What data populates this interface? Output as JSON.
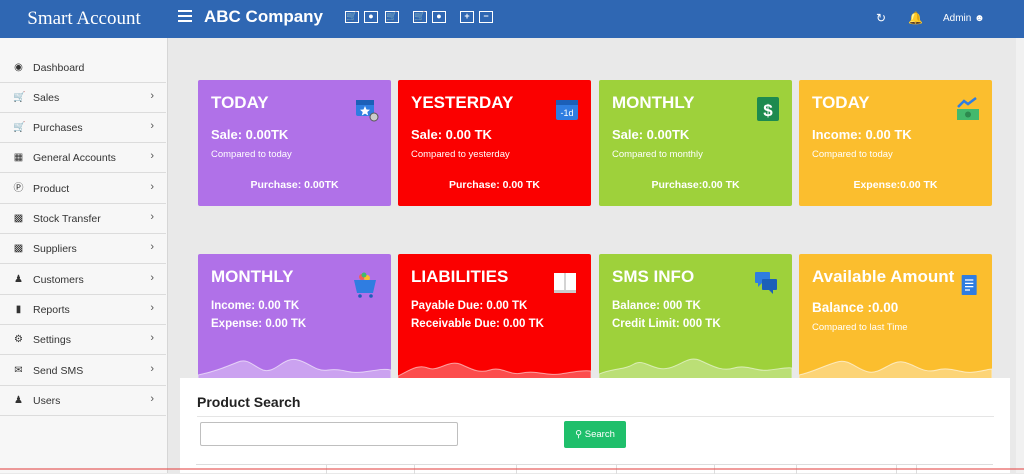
{
  "header": {
    "brand": "Smart Account",
    "company": "ABC Company",
    "admin": "Admin",
    "toolbar_icons": [
      "cart-icon",
      "cash-icon",
      "cart-icon",
      "cart-icon",
      "cash-icon",
      "plus-icon",
      "minus-icon"
    ]
  },
  "sidebar": {
    "items": [
      {
        "label": "Dashboard",
        "icon": "dashboard-icon",
        "has_submenu": false
      },
      {
        "label": "Sales",
        "icon": "cart-icon",
        "has_submenu": true
      },
      {
        "label": "Purchases",
        "icon": "cart-icon",
        "has_submenu": true
      },
      {
        "label": "General Accounts",
        "icon": "money-icon",
        "has_submenu": true
      },
      {
        "label": "Product",
        "icon": "product-icon",
        "has_submenu": true
      },
      {
        "label": "Stock Transfer",
        "icon": "truck-icon",
        "has_submenu": true
      },
      {
        "label": "Suppliers",
        "icon": "truck-icon",
        "has_submenu": true
      },
      {
        "label": "Customers",
        "icon": "users-icon",
        "has_submenu": true
      },
      {
        "label": "Reports",
        "icon": "book-icon",
        "has_submenu": true
      },
      {
        "label": "Settings",
        "icon": "gear-icon",
        "has_submenu": true
      },
      {
        "label": "Send SMS",
        "icon": "envelope-icon",
        "has_submenu": true
      },
      {
        "label": "Users",
        "icon": "users-icon",
        "has_submenu": true
      }
    ]
  },
  "cards": [
    {
      "title": "TODAY",
      "line1": "Sale: 0.00TK",
      "line2": "Compared to today",
      "footer": "Purchase: 0.00TK",
      "color": "#b071e8",
      "icon": "calendar-star-icon"
    },
    {
      "title": "YESTERDAY",
      "line1": "Sale: 0.00 TK",
      "line2": "Compared to yesterday",
      "footer": "Purchase: 0.00 TK",
      "color": "#fb0000",
      "icon": "calendar-minus-1d-icon",
      "icon_text": "-1d"
    },
    {
      "title": "MONTHLY",
      "line1": "Sale: 0.00TK",
      "line2": "Compared to monthly",
      "footer": "Purchase:0.00 TK",
      "color": "#9ed13b",
      "icon": "dollar-icon"
    },
    {
      "title": "TODAY",
      "line1": "Income: 0.00 TK",
      "line2": "Compared to today",
      "footer": "Expense:0.00 TK",
      "color": "#fbbe2e",
      "icon": "income-chart-icon"
    },
    {
      "title": "MONTHLY",
      "line1": "Income: 0.00 TK",
      "line2": "Expense: 0.00 TK",
      "color": "#b071e8",
      "icon": "basket-icon"
    },
    {
      "title": "LIABILITIES",
      "line1": "Payable Due: 0.00 TK",
      "line2": "Receivable Due: 0.00 TK",
      "color": "#fb0000",
      "icon": "book-open-icon"
    },
    {
      "title": "SMS INFO",
      "line1": "Balance: 000 TK",
      "line2": "Credit Limit: 000 TK",
      "color": "#9ed13b",
      "icon": "chat-icon"
    },
    {
      "title": "Available Amount",
      "line1": "Balance :0.00",
      "line2": "Compared to last Time",
      "color": "#fbbe2e",
      "icon": "receipt-icon"
    }
  ],
  "product_search": {
    "title": "Product Search",
    "input_value": "",
    "button": "Search"
  }
}
